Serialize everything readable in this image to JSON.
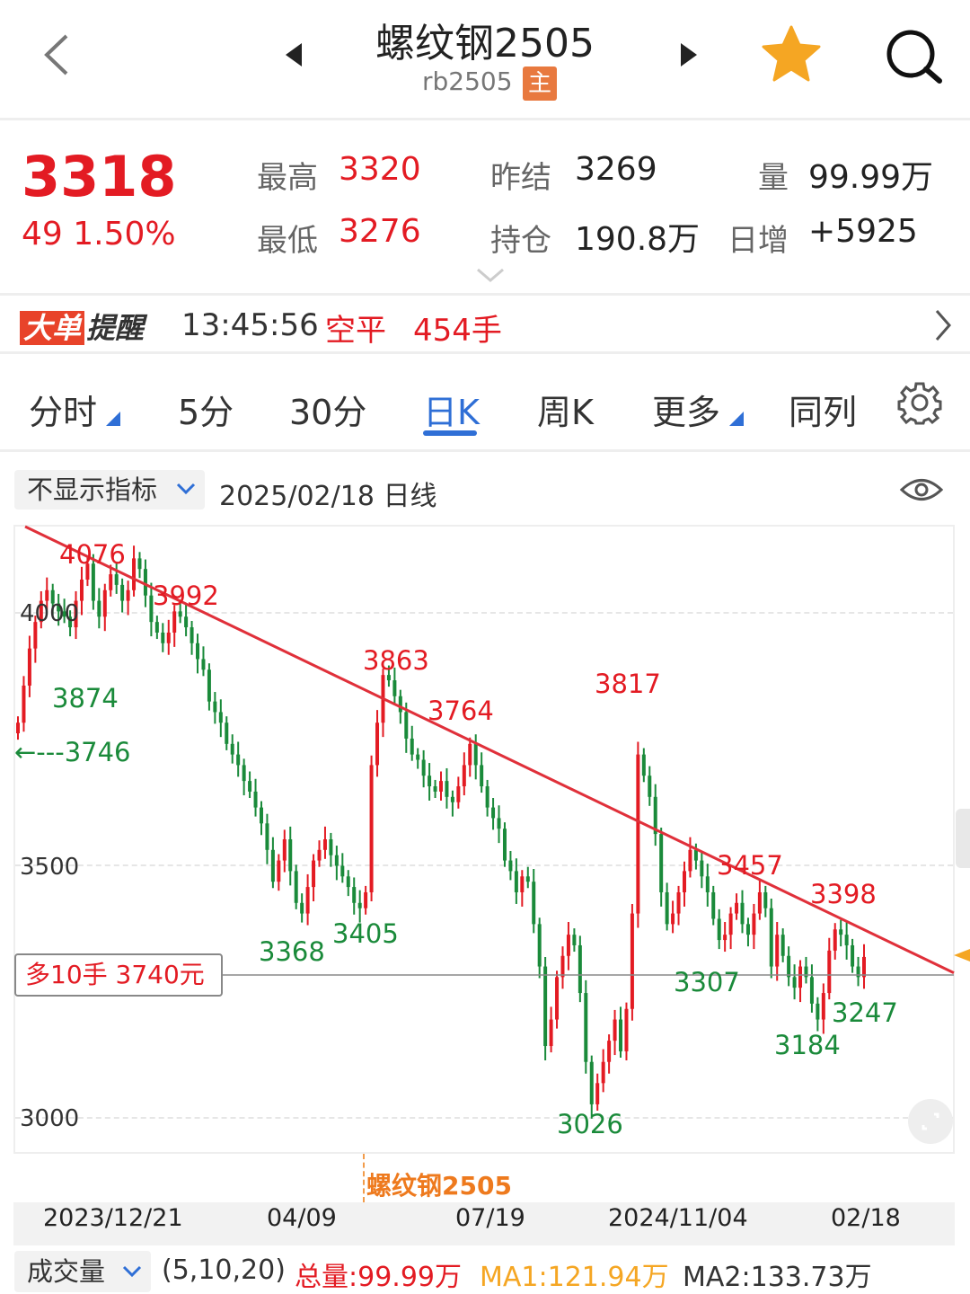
{
  "header": {
    "title": "螺纹钢2505",
    "code": "rb2505",
    "main_badge": "主"
  },
  "quote": {
    "price": "3318",
    "change": "49  1.50%",
    "high_label": "最高",
    "high": "3320",
    "low_label": "最低",
    "low": "3276",
    "prev_settle_label": "昨结",
    "prev_settle": "3269",
    "volume_label": "量",
    "volume": "99.99万",
    "open_interest_label": "持仓",
    "open_interest": "190.8万",
    "daily_change_label": "日增",
    "daily_change": "+5925"
  },
  "alert": {
    "logo_part1": "大单",
    "logo_part2": "提醒",
    "time": "13:45:56",
    "action": "空平",
    "amount": "454手"
  },
  "tabs": [
    {
      "label": "分时"
    },
    {
      "label": "5分"
    },
    {
      "label": "30分"
    },
    {
      "label": "日K"
    },
    {
      "label": "周K"
    },
    {
      "label": "更多"
    },
    {
      "label": "同列"
    }
  ],
  "chart_toolbar": {
    "indicator_label": "不显示指标",
    "date_line": "2025/02/18  日线"
  },
  "chart_data": {
    "type": "candlestick",
    "y_ticks": [
      "4000",
      "3500",
      "3000"
    ],
    "ylim": [
      2950,
      4130
    ],
    "x_ticks": [
      "2023/12/21",
      "04/09",
      "07/19",
      "2024/11/04",
      "02/18"
    ],
    "instrument_marker": "螺纹钢2505",
    "peaks": [
      {
        "label": "4076",
        "color": "red"
      },
      {
        "label": "3992",
        "color": "red"
      },
      {
        "label": "3863",
        "color": "red"
      },
      {
        "label": "3764",
        "color": "red"
      },
      {
        "label": "3817",
        "color": "red"
      },
      {
        "label": "3457",
        "color": "red"
      },
      {
        "label": "3398",
        "color": "red"
      },
      {
        "label": "3874",
        "color": "green"
      },
      {
        "label": "←---3746",
        "color": "green"
      },
      {
        "label": "3368",
        "color": "green"
      },
      {
        "label": "3405",
        "color": "green"
      },
      {
        "label": "3026",
        "color": "green"
      },
      {
        "label": "3307",
        "color": "green"
      },
      {
        "label": "3184",
        "color": "green"
      },
      {
        "label": "3247",
        "color": "green"
      }
    ],
    "trendline": {
      "from": 4130,
      "to": 3288,
      "color": "#e0303a"
    },
    "position_line": 3740,
    "position_label": "多10手  3740元",
    "closes": [
      3760,
      3830,
      3900,
      3950,
      3990,
      4010,
      3985,
      3970,
      3960,
      3940,
      3990,
      4030,
      4060,
      3990,
      3960,
      4010,
      4040,
      4020,
      3990,
      4010,
      4070,
      4050,
      4000,
      3950,
      3930,
      3910,
      3930,
      3970,
      3960,
      3940,
      3910,
      3880,
      3860,
      3800,
      3780,
      3760,
      3720,
      3700,
      3680,
      3650,
      3630,
      3600,
      3570,
      3520,
      3460,
      3500,
      3540,
      3480,
      3420,
      3400,
      3450,
      3500,
      3520,
      3540,
      3510,
      3490,
      3470,
      3450,
      3420,
      3410,
      3440,
      3680,
      3760,
      3850,
      3840,
      3810,
      3780,
      3730,
      3700,
      3690,
      3660,
      3640,
      3630,
      3650,
      3620,
      3610,
      3640,
      3680,
      3720,
      3680,
      3640,
      3600,
      3580,
      3560,
      3500,
      3480,
      3440,
      3470,
      3460,
      3380,
      3300,
      3150,
      3200,
      3280,
      3320,
      3360,
      3340,
      3250,
      3120,
      3040,
      3080,
      3120,
      3160,
      3200,
      3140,
      3220,
      3400,
      3700,
      3660,
      3620,
      3550,
      3440,
      3380,
      3400,
      3440,
      3480,
      3520,
      3500,
      3470,
      3440,
      3390,
      3350,
      3360,
      3400,
      3420,
      3380,
      3360,
      3400,
      3440,
      3410,
      3300,
      3360,
      3320,
      3280,
      3260,
      3300,
      3280,
      3230,
      3200,
      3250,
      3330,
      3370,
      3360,
      3340,
      3300,
      3280,
      3318
    ]
  },
  "volume_bar": {
    "button_label": "成交量",
    "params": "(5,10,20)",
    "total": "总量:99.99万",
    "ma1": "MA1:121.94万",
    "ma2": "MA2:133.73万"
  },
  "colors": {
    "up": "#e31b23",
    "down": "#1a8a3a",
    "accent": "#2f6fd6",
    "badge": "#e8793f",
    "ma1": "#f5a623"
  }
}
